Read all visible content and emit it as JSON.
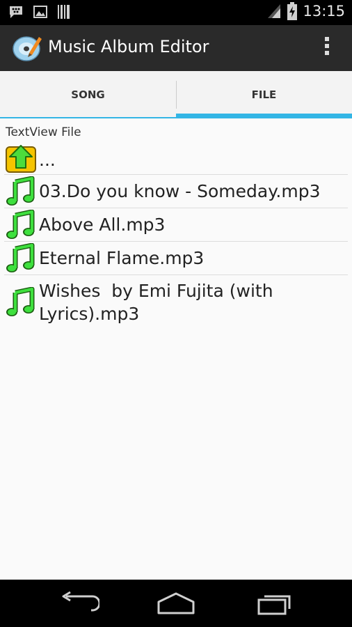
{
  "status_bar": {
    "time": "13:15",
    "icons": [
      "bbm-notification-icon",
      "picture-notification-icon",
      "barcode-notification-icon",
      "signal-icon",
      "battery-charging-icon"
    ]
  },
  "action_bar": {
    "title": "Music Album Editor",
    "app_icon": "disc-pencil-icon",
    "menu_icon": "overflow-menu-icon"
  },
  "tabs": [
    {
      "label": "SONG",
      "selected": false
    },
    {
      "label": "FILE",
      "selected": true
    }
  ],
  "content": {
    "textview_label": "TextView File",
    "items": [
      {
        "name": "...",
        "icon": "up-folder-icon"
      },
      {
        "name": "03.Do you know - Someday.mp3",
        "icon": "music-note-icon"
      },
      {
        "name": "Above All.mp3",
        "icon": "music-note-icon"
      },
      {
        "name": "Eternal Flame.mp3",
        "icon": "music-note-icon"
      },
      {
        "name": "Wishes  by Emi Fujita (with\nLyrics).mp3",
        "icon": "music-note-icon"
      }
    ]
  },
  "nav_bar": {
    "buttons": [
      "back-icon",
      "home-icon",
      "recent-apps-icon"
    ]
  },
  "colors": {
    "accent": "#33b5e5",
    "music_note": "#3ee03e",
    "folder_yellow": "#f5c400"
  }
}
